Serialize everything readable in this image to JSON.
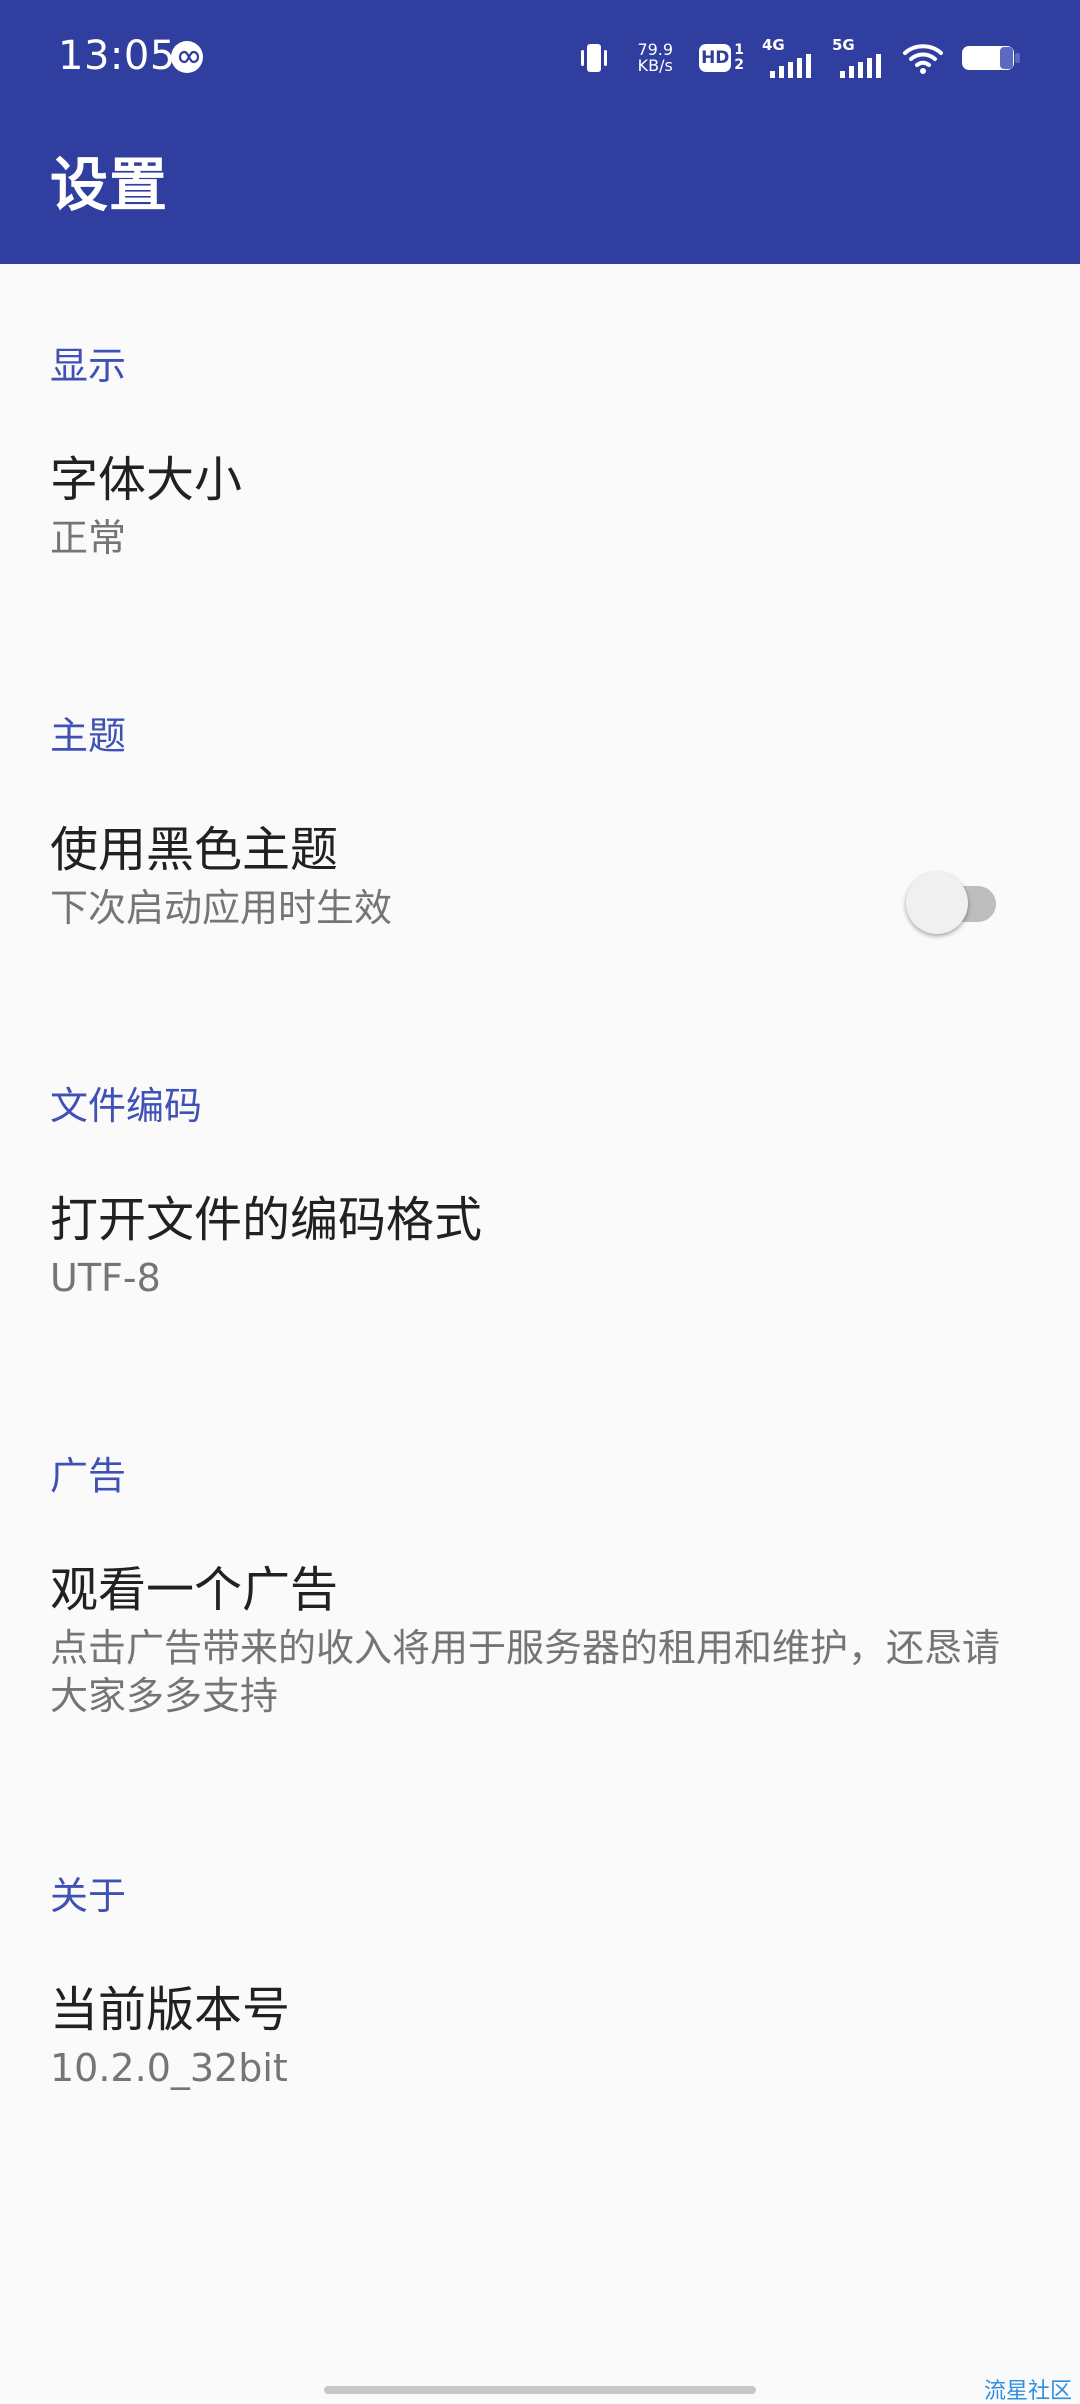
{
  "status_bar": {
    "time": "13:05",
    "network_speed_value": "79.9",
    "network_speed_unit": "KB/s",
    "hd_badge": "HD",
    "sim1": "1",
    "sim2": "2",
    "network_1": "4G",
    "network_2": "5G",
    "colors": {
      "background": "#303f9f",
      "text": "#ffffff"
    }
  },
  "header": {
    "title": "设置"
  },
  "sections": [
    {
      "title": "显示",
      "items": [
        {
          "title": "字体大小",
          "summary": "正常"
        }
      ]
    },
    {
      "title": "主题",
      "items": [
        {
          "title": "使用黑色主题",
          "summary": "下次启动应用时生效",
          "switch_on": false
        }
      ]
    },
    {
      "title": "文件编码",
      "items": [
        {
          "title": "打开文件的编码格式",
          "summary": "UTF-8"
        }
      ]
    },
    {
      "title": "广告",
      "items": [
        {
          "title": "观看一个广告",
          "summary": "点击广告带来的收入将用于服务器的租用和维护，还恳请大家多多支持"
        }
      ]
    },
    {
      "title": "关于",
      "items": [
        {
          "title": "当前版本号",
          "summary": "10.2.0_32bit"
        }
      ]
    }
  ],
  "watermark": "流星社区",
  "colors": {
    "accent": "#3f51b5",
    "primary": "#303f9f",
    "summary_text": "#757575",
    "title_text": "#212121",
    "background": "#fafafa"
  },
  "icons": {
    "status_left": "infinity-icon",
    "vibration": "vibration-icon",
    "signal_4g": "signal-bars-icon",
    "signal_5g": "signal-bars-icon",
    "wifi": "wifi-icon",
    "battery": "battery-icon"
  }
}
